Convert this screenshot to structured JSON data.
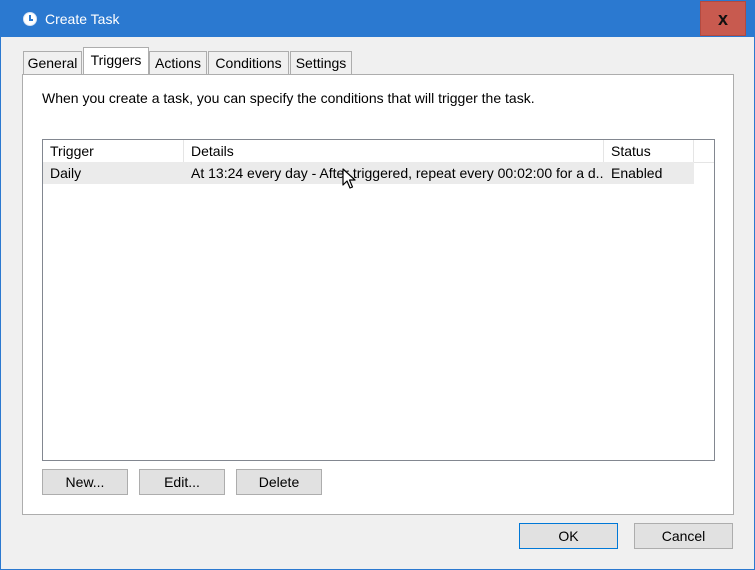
{
  "window": {
    "title": "Create Task",
    "close_glyph": "x",
    "title_icon": "clock-icon"
  },
  "tabs": [
    {
      "label": "General"
    },
    {
      "label": "Triggers"
    },
    {
      "label": "Actions"
    },
    {
      "label": "Conditions"
    },
    {
      "label": "Settings"
    }
  ],
  "active_tab": "Triggers",
  "triggers_panel": {
    "instruction": "When you create a task, you can specify the conditions that will trigger the task.",
    "columns": [
      "Trigger",
      "Details",
      "Status"
    ],
    "rows": [
      {
        "trigger": "Daily",
        "details": "At 13:24 every day - After triggered, repeat every 00:02:00 for a d...",
        "status": "Enabled"
      }
    ],
    "buttons": {
      "new": "New...",
      "edit": "Edit...",
      "delete": "Delete"
    }
  },
  "footer": {
    "ok": "OK",
    "cancel": "Cancel"
  },
  "colors": {
    "titlebar": "#2b79d0",
    "close": "#c85a4f",
    "selected_row": "#ebebeb"
  }
}
